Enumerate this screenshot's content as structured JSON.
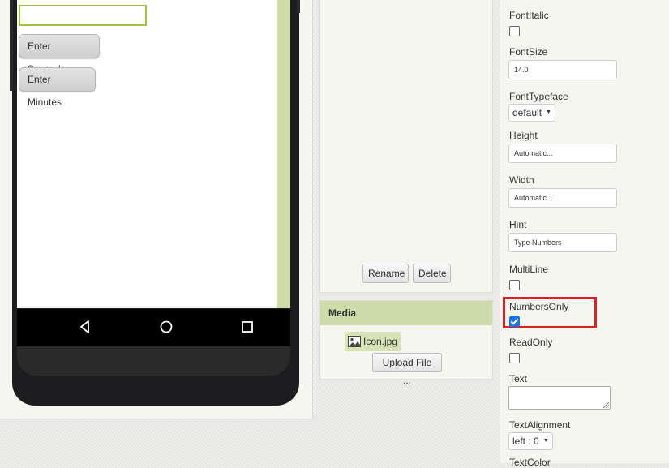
{
  "viewer": {
    "buttons": {
      "enter_seconds": "Enter Seconds",
      "enter_minutes": "Enter Minutes"
    },
    "navbar_icons": [
      "back-icon",
      "home-icon",
      "recent-apps-icon"
    ]
  },
  "components": {
    "rename_label": "Rename",
    "delete_label": "Delete"
  },
  "media": {
    "header": "Media",
    "file_name": "Icon.jpg",
    "upload_label": "Upload File ..."
  },
  "properties": {
    "font_italic": {
      "label": "FontItalic",
      "checked": false
    },
    "font_size": {
      "label": "FontSize",
      "value": "14.0"
    },
    "font_typeface": {
      "label": "FontTypeface",
      "value": "default"
    },
    "height": {
      "label": "Height",
      "value": "Automatic..."
    },
    "width": {
      "label": "Width",
      "value": "Automatic..."
    },
    "hint": {
      "label": "Hint",
      "value": "Type Numbers"
    },
    "multi_line": {
      "label": "MultiLine",
      "checked": false
    },
    "numbers_only": {
      "label": "NumbersOnly",
      "checked": true
    },
    "read_only": {
      "label": "ReadOnly",
      "checked": false
    },
    "text": {
      "label": "Text",
      "value": ""
    },
    "text_alignment": {
      "label": "TextAlignment",
      "value": "left : 0"
    },
    "text_color": {
      "label": "TextColor"
    }
  },
  "colors": {
    "accent_green": "#cddca8",
    "textbox_border": "#9fc23c",
    "highlight_red": "#e02020",
    "checkbox_blue": "#1a73e8"
  }
}
